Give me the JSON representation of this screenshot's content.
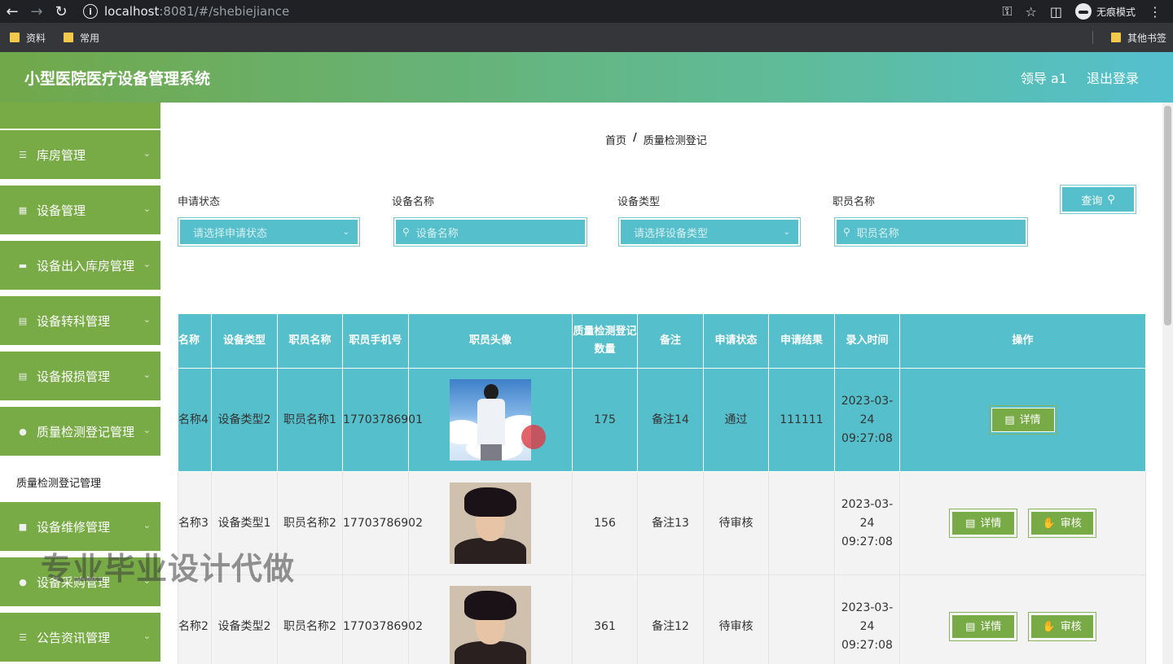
{
  "browser": {
    "url_host": "localhost",
    "url_rest": ":8081/#/shebiejiance",
    "incognito_label": "无痕模式",
    "bookmarks": [
      "资料",
      "常用"
    ],
    "other_bookmarks": "其他书签"
  },
  "header": {
    "title": "小型医院医疗设备管理系统",
    "user": "领导 a1",
    "logout": "退出登录"
  },
  "sidebar": {
    "items": [
      {
        "label": "库房管理",
        "icon": "list-icon"
      },
      {
        "label": "设备管理",
        "icon": "grid-icon"
      },
      {
        "label": "设备出入库房管理",
        "icon": "box-icon"
      },
      {
        "label": "设备转科管理",
        "icon": "clipboard-icon"
      },
      {
        "label": "设备报损管理",
        "icon": "document-icon"
      },
      {
        "label": "质量检测登记管理",
        "icon": "user-icon"
      },
      {
        "label": "设备维修管理",
        "icon": "tool-icon"
      },
      {
        "label": "设备采购管理",
        "icon": "pin-icon"
      },
      {
        "label": "公告资讯管理",
        "icon": "list-icon"
      }
    ],
    "submenu": "质量检测登记管理"
  },
  "breadcrumb": {
    "home": "首页",
    "sep": "/",
    "current": "质量检测登记"
  },
  "filters": {
    "status_label": "申请状态",
    "status_placeholder": "请选择申请状态",
    "name_label": "设备名称",
    "name_placeholder": "设备名称",
    "type_label": "设备类型",
    "type_placeholder": "请选择设备类型",
    "staff_label": "职员名称",
    "staff_placeholder": "职员名称",
    "query": "查询"
  },
  "table": {
    "headers": [
      "名称",
      "设备类型",
      "职员名称",
      "职员手机号",
      "职员头像",
      "质量检测登记数量",
      "备注",
      "申请状态",
      "申请结果",
      "录入时间",
      "操作"
    ],
    "rows": [
      {
        "name": "名称4",
        "type": "设备类型2",
        "staff": "职员名称1",
        "phone": "17703786901",
        "count": "175",
        "note": "备注14",
        "status": "通过",
        "result": "111111",
        "time": "2023-03-24 09:27:08",
        "avatar": "sky"
      },
      {
        "name": "名称3",
        "type": "设备类型1",
        "staff": "职员名称2",
        "phone": "17703786902",
        "count": "156",
        "note": "备注13",
        "status": "待审核",
        "result": "",
        "time": "2023-03-24 09:27:08",
        "avatar": "dark"
      },
      {
        "name": "名称2",
        "type": "设备类型2",
        "staff": "职员名称2",
        "phone": "17703786902",
        "count": "361",
        "note": "备注12",
        "status": "待审核",
        "result": "",
        "time": "2023-03-24 09:27:08",
        "avatar": "dark"
      }
    ],
    "detail_label": "详情",
    "audit_label": "审核"
  },
  "watermark": "专业毕业设计代做"
}
